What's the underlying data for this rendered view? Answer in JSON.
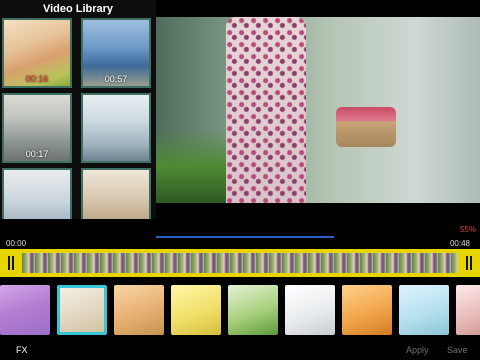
{
  "library": {
    "title": "Video Library",
    "items": [
      {
        "duration": "00:16"
      },
      {
        "duration": "00:57"
      },
      {
        "duration": ""
      },
      {
        "duration": ""
      },
      {
        "duration": "00:17"
      },
      {
        "duration": ""
      }
    ]
  },
  "progress": {
    "percent_label": "55%",
    "value": 0.55
  },
  "timeline": {
    "start": "00:00",
    "end": "00:48"
  },
  "toolbar": {
    "fx": "FX",
    "apply": "Apply",
    "save": "Save"
  },
  "colors": {
    "accent_selected": "#39c3d6",
    "timeline_yellow": "#e8d400",
    "progress_blue": "#2d5fc8",
    "percent_red": "#e03a3a"
  }
}
